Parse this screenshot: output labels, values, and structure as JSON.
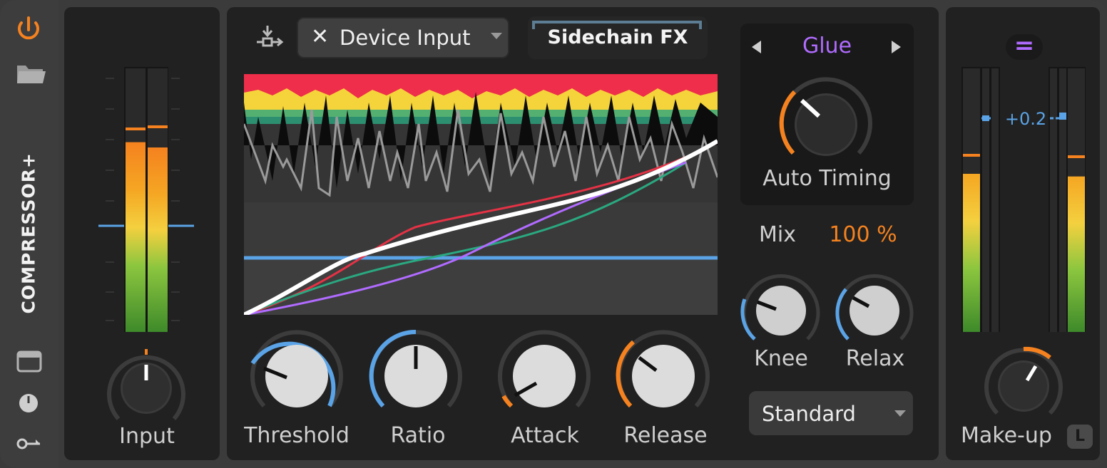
{
  "device": {
    "title": "COMPRESSOR+"
  },
  "sidebar": {
    "icons": [
      "power-icon",
      "folder-icon",
      "window-icon",
      "clock-icon",
      "key-icon"
    ]
  },
  "input": {
    "label": "Input",
    "meter_fill_left": 0.72,
    "meter_fill_right": 0.7,
    "level_marker": 0.4
  },
  "sidechain": {
    "input_label": "Device Input",
    "fx_label": "Sidechain FX"
  },
  "preset": {
    "name": "Glue",
    "auto_timing_label": "Auto Timing"
  },
  "mix": {
    "label": "Mix",
    "value": "100 %"
  },
  "knobs": {
    "threshold": {
      "label": "Threshold"
    },
    "ratio": {
      "label": "Ratio"
    },
    "attack": {
      "label": "Attack"
    },
    "release": {
      "label": "Release"
    },
    "knee": {
      "label": "Knee"
    },
    "relax": {
      "label": "Relax"
    },
    "makeup": {
      "label": "Make-up"
    }
  },
  "mode": {
    "selected": "Standard"
  },
  "output": {
    "gain_readout": "+0.2",
    "meter_fill_left": 0.6,
    "meter_fill_right": 0.59,
    "link_badge": "L",
    "eq_badge": "="
  },
  "colors": {
    "accent_orange": "#f5821f",
    "accent_blue": "#5aa3e6",
    "accent_purple": "#b06bff",
    "panel": "#212121"
  }
}
